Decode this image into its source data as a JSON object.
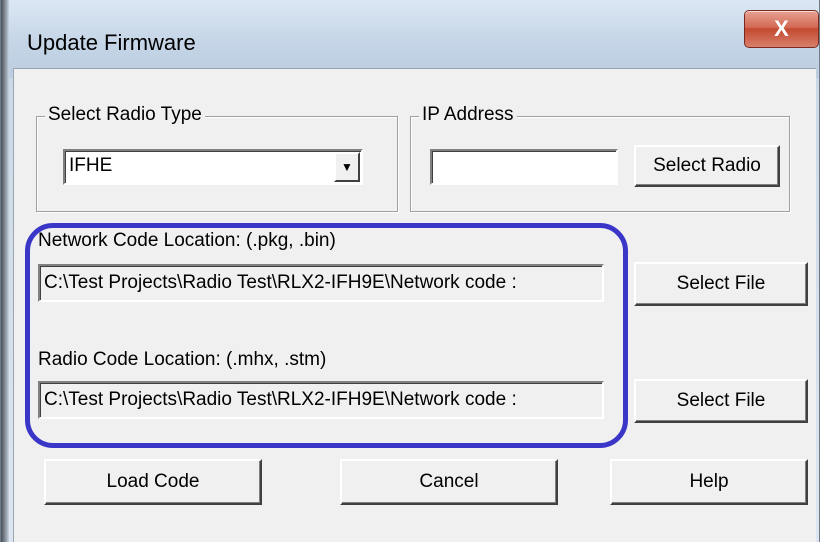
{
  "window": {
    "title": "Update Firmware",
    "close_icon": "X"
  },
  "radio_type": {
    "group_label": "Select Radio Type",
    "selected": "IFHE",
    "arrow_icon": "▼"
  },
  "ip_address": {
    "group_label": "IP Address",
    "value": "",
    "select_button": "Select Radio"
  },
  "network_code": {
    "label": "Network Code Location: (.pkg, .bin)",
    "path": "C:\\Test Projects\\Radio Test\\RLX2-IFH9E\\Network code :",
    "select_button": "Select File"
  },
  "radio_code": {
    "label": "Radio Code Location: (.mhx, .stm)",
    "path": "C:\\Test Projects\\Radio Test\\RLX2-IFH9E\\Network code :",
    "select_button": "Select File"
  },
  "actions": {
    "load": "Load Code",
    "cancel": "Cancel",
    "help": "Help"
  },
  "colors": {
    "highlight": "#3a37c8",
    "close_button": "#c34a31"
  }
}
